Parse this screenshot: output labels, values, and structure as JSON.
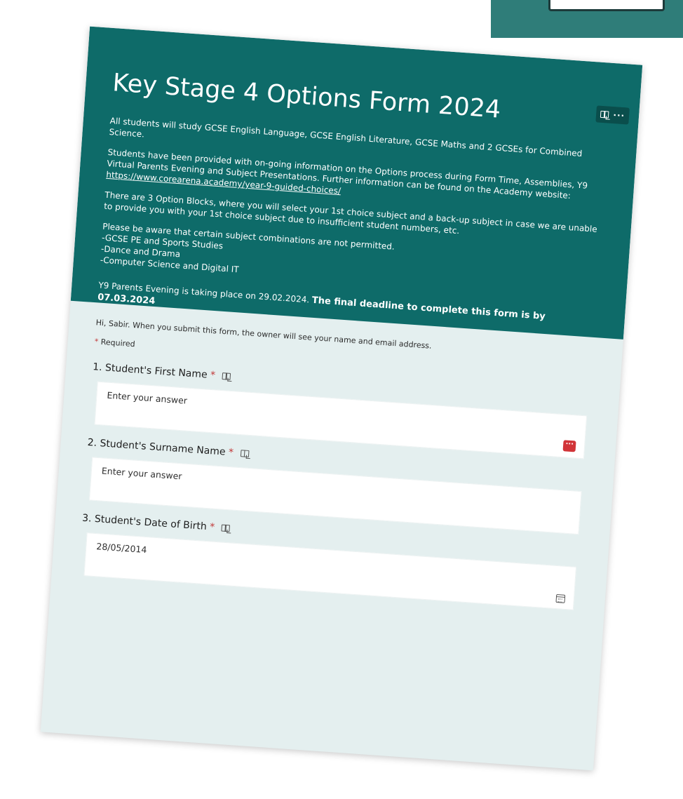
{
  "form": {
    "title": "Key Stage 4 Options Form 2024",
    "description": [
      "All students will study GCSE English Language, GCSE English Literature, GCSE Maths and 2 GCSEs for Combined Science.",
      "Students have been provided with on-going information on the Options process during Form Time, Assemblies, Y9 Virtual Parents Evening and Subject Presentations.  Further information can be found on the Academy website: ",
      "There are 3 Option Blocks, where you will select your 1st choice subject and a back-up subject in case we are unable to provide you with your 1st choice subject due to insufficient student numbers, etc.",
      "Please be aware that certain subject combinations are not permitted.",
      "-GCSE PE and Sports Studies",
      "-Dance and Drama",
      "-Computer Science and Digital IT"
    ],
    "website_link": "https://www.corearena.academy/year-9-guided-choices/",
    "parents_evening": "Y9 Parents Evening is taking place on 29.02.2024. ",
    "deadline": "The final deadline to complete this form is by 07.03.2024",
    "header_tools": {
      "immersive_reader_icon": "book-reader-icon",
      "more": "···"
    }
  },
  "notice": "Hi, Sabir. When you submit this form, the owner will see your name and email address.",
  "required_note": {
    "star": "*",
    "label": " Required"
  },
  "questions": [
    {
      "label": "1. Student's First Name",
      "star": "*",
      "placeholder": "Enter your answer",
      "value": "",
      "icon": "book-reader-icon",
      "extra": "ellipsis-button"
    },
    {
      "label": "2. Student's Surname Name",
      "star": "*",
      "placeholder": "Enter your answer",
      "value": "",
      "icon": "book-reader-icon"
    },
    {
      "label": "3. Student's Date of Birth",
      "star": "*",
      "placeholder": "",
      "value": "28/05/2014",
      "icon": "book-reader-icon",
      "extra": "calendar-icon"
    }
  ],
  "colors": {
    "header": "#0e6b69",
    "page": "#e4efef",
    "accent_red": "#d13438"
  }
}
